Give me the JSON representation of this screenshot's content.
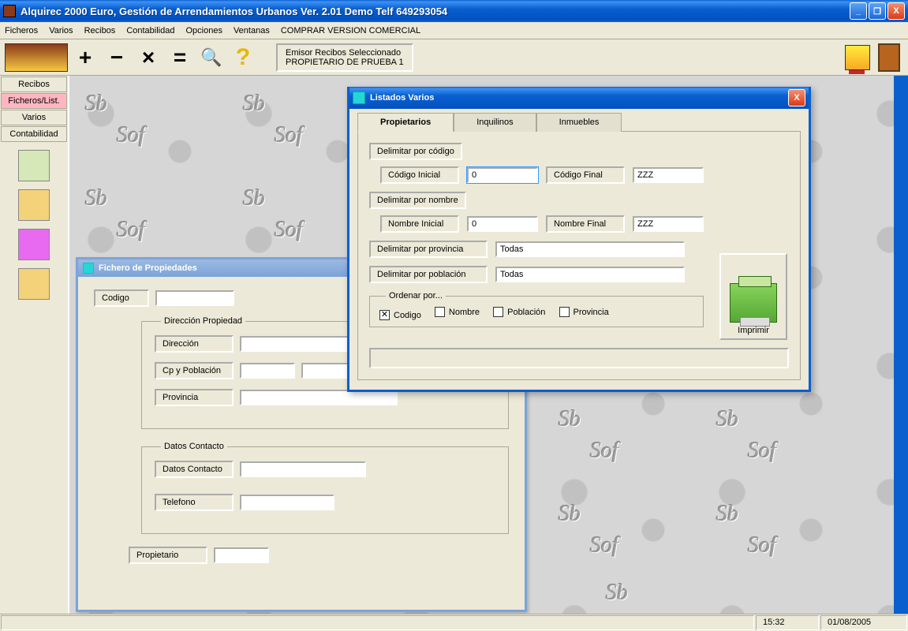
{
  "window": {
    "title": "Alquirec 2000 Euro, Gestión de Arrendamientos Urbanos Ver. 2.01 Demo Telf 649293054"
  },
  "menu": {
    "items": [
      "Ficheros",
      "Varios",
      "Recibos",
      "Contabilidad",
      "Opciones",
      "Ventanas",
      "COMPRAR VERSION COMERCIAL"
    ]
  },
  "toolbar": {
    "emisor_line1": "Emisor Recibos Seleccionado",
    "emisor_line2": "PROPIETARIO DE PRUEBA 1"
  },
  "sidebar": {
    "nav": [
      "Recibos",
      "Ficheros/List.",
      "Varios",
      "Contabilidad"
    ],
    "active_index": 1
  },
  "fichero_window": {
    "title": "Fichero de Propiedades",
    "fields": {
      "codigo_label": "Codigo",
      "direccion_group": "Dirección Propiedad",
      "direccion_label": "Dirección",
      "cp_label": "Cp y Población",
      "provincia_label": "Provincia",
      "datos_group": "Datos Contacto",
      "datos_label": "Datos Contacto",
      "telefono_label": "Telefono",
      "propietario_label": "Propietario"
    }
  },
  "dialog": {
    "title": "Listados Varios",
    "tabs": [
      "Propietarios",
      "Inquilinos",
      "Inmuebles"
    ],
    "active_tab": 0,
    "delim_codigo": "Delimitar por código",
    "codigo_inicial_label": "Código Inicial",
    "codigo_inicial_value": "0",
    "codigo_final_label": "Código Final",
    "codigo_final_value": "ZZZ",
    "delim_nombre": "Delimitar por nombre",
    "nombre_inicial_label": "Nombre Inicial",
    "nombre_inicial_value": "0",
    "nombre_final_label": "Nombre Final",
    "nombre_final_value": "ZZZ",
    "delim_provincia_label": "Delimitar por provincia",
    "provincia_value": "Todas",
    "delim_poblacion_label": "Delimitar por población",
    "poblacion_value": "Todas",
    "ordenar_legend": "Ordenar por...",
    "ordenar_options": [
      "Codigo",
      "Nombre",
      "Población",
      "Provincia"
    ],
    "ordenar_checked": 0,
    "imprimir_label": "Imprimir"
  },
  "statusbar": {
    "time": "15:32",
    "date": "01/08/2005"
  }
}
